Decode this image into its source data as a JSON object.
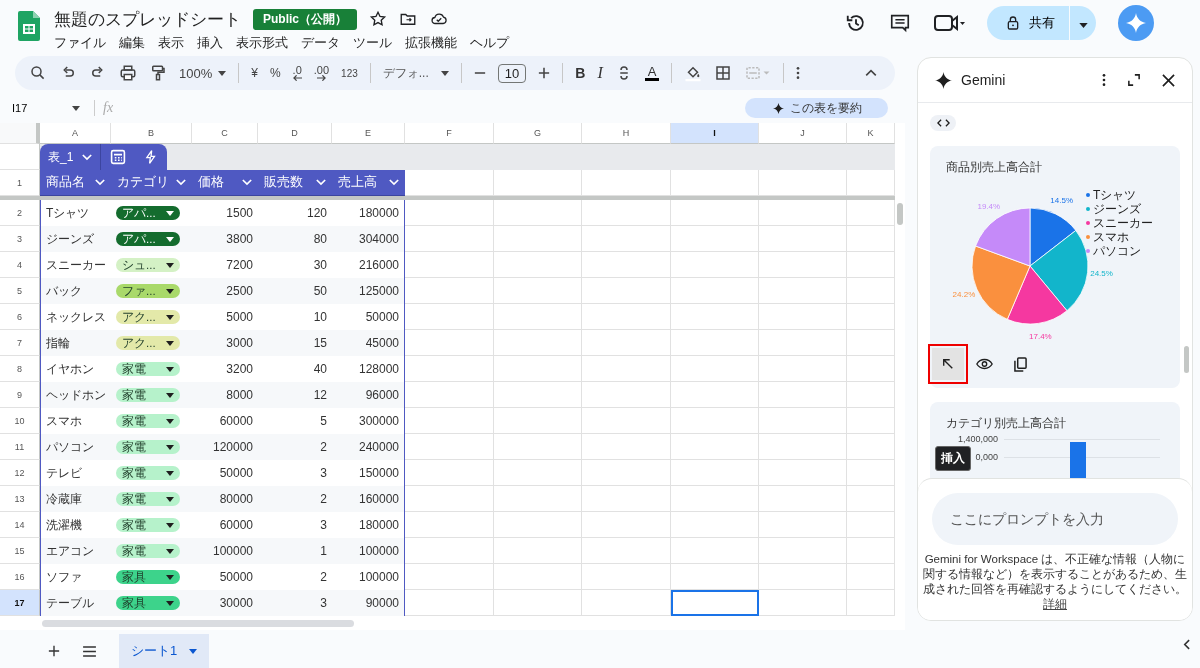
{
  "document": {
    "title": "無題のスプレッドシート",
    "badge": "Public（公開）"
  },
  "menu": [
    "ファイル",
    "編集",
    "表示",
    "挿入",
    "表示形式",
    "データ",
    "ツール",
    "拡張機能",
    "ヘルプ"
  ],
  "share": {
    "label": "共有"
  },
  "toolbar": {
    "zoom": "100%",
    "currency": "¥",
    "percent": "%",
    "decrease_decimal": ".0",
    "increase_decimal": ".00",
    "number_format": "123",
    "font": "デフォ...",
    "font_size": "10",
    "bold": "B",
    "italic": "I",
    "text_color": "A"
  },
  "name_box": "I17",
  "formula_label": "fx",
  "summarize_button": "この表を要約",
  "columns": [
    {
      "label": "A",
      "selected": false
    },
    {
      "label": "B",
      "selected": false
    },
    {
      "label": "C",
      "selected": false
    },
    {
      "label": "D",
      "selected": false
    },
    {
      "label": "E",
      "selected": false
    },
    {
      "label": "F",
      "selected": false
    },
    {
      "label": "G",
      "selected": false
    },
    {
      "label": "H",
      "selected": false
    },
    {
      "label": "I",
      "selected": true
    },
    {
      "label": "J",
      "selected": false
    },
    {
      "label": "K",
      "selected": false
    }
  ],
  "table": {
    "name": "表_1",
    "header_row": "1",
    "headers": [
      "商品名",
      "カテゴリ",
      "価格",
      "販売数",
      "売上高"
    ],
    "rows": [
      {
        "row": "2",
        "selected": false,
        "product": "Tシャツ",
        "category": {
          "label": "アパ...",
          "color": "#146c2e"
        },
        "price": "1500",
        "quantity": "120",
        "sales": "180000"
      },
      {
        "row": "3",
        "selected": false,
        "product": "ジーンズ",
        "category": {
          "label": "アパ...",
          "color": "#146c2e"
        },
        "price": "3800",
        "quantity": "80",
        "sales": "304000"
      },
      {
        "row": "4",
        "selected": false,
        "product": "スニーカー",
        "category": {
          "label": "シュ...",
          "color": "#d4f1c5"
        },
        "price": "7200",
        "quantity": "30",
        "sales": "216000"
      },
      {
        "row": "5",
        "selected": false,
        "product": "バック",
        "category": {
          "label": "ファ...",
          "color": "#a9d96a"
        },
        "price": "2500",
        "quantity": "50",
        "sales": "125000"
      },
      {
        "row": "6",
        "selected": false,
        "product": "ネックレス",
        "category": {
          "label": "アク...",
          "color": "#e3e9a9"
        },
        "price": "5000",
        "quantity": "10",
        "sales": "50000"
      },
      {
        "row": "7",
        "selected": false,
        "product": "指輪",
        "category": {
          "label": "アク...",
          "color": "#e3e9a9"
        },
        "price": "3000",
        "quantity": "15",
        "sales": "45000"
      },
      {
        "row": "8",
        "selected": false,
        "product": "イヤホン",
        "category": {
          "label": "家電",
          "color": "#b6f2cb"
        },
        "price": "3200",
        "quantity": "40",
        "sales": "128000"
      },
      {
        "row": "9",
        "selected": false,
        "product": "ヘッドホン",
        "category": {
          "label": "家電",
          "color": "#b6f2cb"
        },
        "price": "8000",
        "quantity": "12",
        "sales": "96000"
      },
      {
        "row": "10",
        "selected": false,
        "product": "スマホ",
        "category": {
          "label": "家電",
          "color": "#b6f2cb"
        },
        "price": "60000",
        "quantity": "5",
        "sales": "300000"
      },
      {
        "row": "11",
        "selected": false,
        "product": "パソコン",
        "category": {
          "label": "家電",
          "color": "#b6f2cb"
        },
        "price": "120000",
        "quantity": "2",
        "sales": "240000"
      },
      {
        "row": "12",
        "selected": false,
        "product": "テレビ",
        "category": {
          "label": "家電",
          "color": "#b6f2cb"
        },
        "price": "50000",
        "quantity": "3",
        "sales": "150000"
      },
      {
        "row": "13",
        "selected": false,
        "product": "冷蔵庫",
        "category": {
          "label": "家電",
          "color": "#b6f2cb"
        },
        "price": "80000",
        "quantity": "2",
        "sales": "160000"
      },
      {
        "row": "14",
        "selected": false,
        "product": "洗濯機",
        "category": {
          "label": "家電",
          "color": "#b6f2cb"
        },
        "price": "60000",
        "quantity": "3",
        "sales": "180000"
      },
      {
        "row": "15",
        "selected": false,
        "product": "エアコン",
        "category": {
          "label": "家電",
          "color": "#b6f2cb"
        },
        "price": "100000",
        "quantity": "1",
        "sales": "100000"
      },
      {
        "row": "16",
        "selected": false,
        "product": "ソファ",
        "category": {
          "label": "家具",
          "color": "#3dd38b"
        },
        "price": "50000",
        "quantity": "2",
        "sales": "100000"
      },
      {
        "row": "17",
        "selected": true,
        "product": "テーブル",
        "category": {
          "label": "家具",
          "color": "#3dd38b"
        },
        "price": "30000",
        "quantity": "3",
        "sales": "90000"
      }
    ]
  },
  "sheets": [
    {
      "label": "シート1",
      "selected": true
    }
  ],
  "gemini": {
    "title": "Gemini",
    "pie_card": {
      "chart_data": {
        "type": "pie",
        "title": "商品別売上高合計",
        "categories": [
          "Tシャツ",
          "ジーンズ",
          "スニーカー",
          "スマホ",
          "パソコン"
        ],
        "values": [
          14.5,
          24.5,
          17.4,
          24.2,
          19.4
        ],
        "colors": [
          "#1a73e8",
          "#12b5cb",
          "#f538a0",
          "#fa903e",
          "#c58af9"
        ],
        "value_labels": [
          "14.5%",
          "24.5%",
          "17.4%",
          "24.2%",
          "19.4%"
        ]
      },
      "actions": [
        {
          "kind": "insert",
          "highlighted": true
        },
        {
          "kind": "preview",
          "highlighted": false
        },
        {
          "kind": "copy",
          "highlighted": false
        }
      ],
      "tooltip": "挿入"
    },
    "bar_card": {
      "title": "カテゴリ別売上高合計",
      "tick_labels": [
        "1,400,000",
        "0,000"
      ]
    },
    "prompt": {
      "placeholder": "ここにプロンプトを入力"
    },
    "disclaimer": "Gemini for Workspace は、不正確な情報（人物に関する情報など）を表示することがあるため、生成された回答を再確認するようにしてください。",
    "disclaimer_link": "詳細"
  }
}
